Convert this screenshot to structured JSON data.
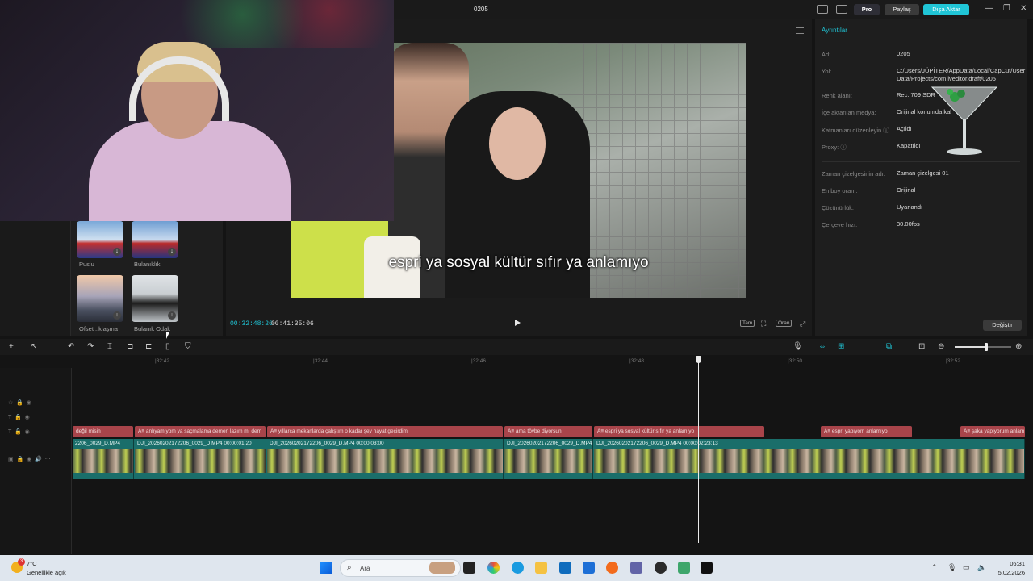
{
  "topbar": {
    "project_title": "0205",
    "pro_label": "Pro",
    "share_label": "Paylaş",
    "export_label": "Dışa Aktar"
  },
  "left_panel": {
    "effects": [
      {
        "label": "Puslu"
      },
      {
        "label": "Bulanıklık"
      },
      {
        "label": "Ofset ..klaşma"
      },
      {
        "label": "Bulanık Odak"
      }
    ]
  },
  "player": {
    "subtitle": "espri ya sosyal kültür sıfır ya anlamıyo",
    "current_time": "00:32:48:26",
    "total_time": "00:41:35:06",
    "ctl_full": "Tam",
    "ctl_ratio": "Oran"
  },
  "details": {
    "title": "Ayrıntılar",
    "rows": [
      {
        "label": "Ad:",
        "value": "0205"
      },
      {
        "label": "Yol:",
        "value": "C:/Users/JÜPİTER/AppData/Local/CapCut/User Data/Projects/com.lveditor.draft/0205"
      },
      {
        "label": "Renk alanı:",
        "value": "Rec. 709 SDR"
      },
      {
        "label": "İçe aktarılan medya:",
        "value": "Orijinal konumda kal"
      },
      {
        "label": "Katmanları düzenleyin ⓘ",
        "value": "Açıldı"
      },
      {
        "label": "Proxy: ⓘ",
        "value": "Kapatıldı"
      },
      {
        "label": "Zaman çizelgesinin adı:",
        "value": "Zaman çizelgesi 01"
      },
      {
        "label": "En boy oranı:",
        "value": "Orijinal"
      },
      {
        "label": "Çözünürlük:",
        "value": "Uyarlandı"
      },
      {
        "label": "Çerçeve hızı:",
        "value": "30.00fps"
      }
    ],
    "change_label": "Değiştir"
  },
  "timeline": {
    "ticks": [
      "|32:42",
      "|32:44",
      "|32:46",
      "|32:48",
      "|32:50",
      "|32:52"
    ],
    "text_clips": [
      {
        "text": "değil misin"
      },
      {
        "text": "A≡ anlıyamıyom ya saçmalama demen lazım mı dem"
      },
      {
        "text": "A≡ yıllarca mekanlarda çalıştım o kadar şey hayat geçirdim"
      },
      {
        "text": "A≡ ama tövbe diyorsun"
      },
      {
        "text": "A≡ espri ya sosyal kültür sıfır ya anlamıyo"
      },
      {
        "text": "A≡ espri yapıyom anlamıyo"
      },
      {
        "text": "A≡ şaka yapıyorum anlam"
      }
    ],
    "video_clips": [
      {
        "name": "2206_0029_D.MP4"
      },
      {
        "name": "DJI_20260202172206_0029_D.MP4   00:00:01:20"
      },
      {
        "name": "DJI_20260202172206_0029_D.MP4   00:00:03:00"
      },
      {
        "name": "DJI_20260202172206_0029_D.MP4"
      },
      {
        "name": "DJI_20260202172206_0029_D.MP4   00:00:02:23:13"
      }
    ]
  },
  "taskbar": {
    "temperature": "7°C",
    "weather": "Genellikle açık",
    "weather_badge": "3",
    "search_placeholder": "Ara",
    "time": "06:31",
    "date": "5.02.2026"
  },
  "colors": {
    "accent": "#20c5d6",
    "text_clip": "#a8444a",
    "video_track": "#1a6e6a"
  }
}
